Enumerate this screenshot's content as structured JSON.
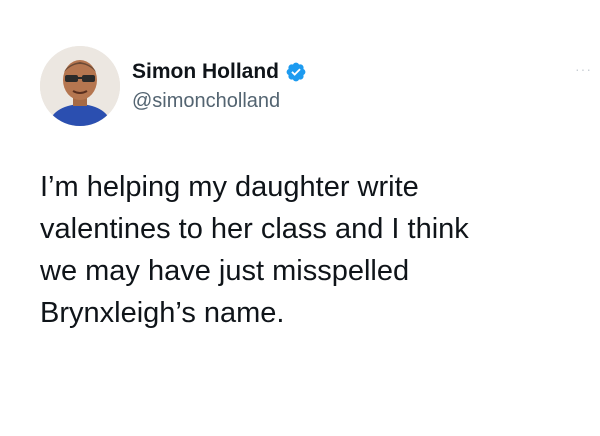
{
  "tweet": {
    "author": {
      "display_name": "Simon Holland",
      "handle": "@simoncholland",
      "verified": true
    },
    "text_lines": [
      "I’m helping my daughter write",
      "valentines to her class and I think",
      "we may have just misspelled",
      "Brynxleigh’s name."
    ],
    "more_icon": "···"
  },
  "icons": {
    "avatar": "avatar",
    "verified": "verified-badge-icon",
    "more": "more-options-icon"
  },
  "colors": {
    "verified_blue": "#1d9bf0",
    "text": "#0f1419",
    "secondary_text": "#536471"
  }
}
